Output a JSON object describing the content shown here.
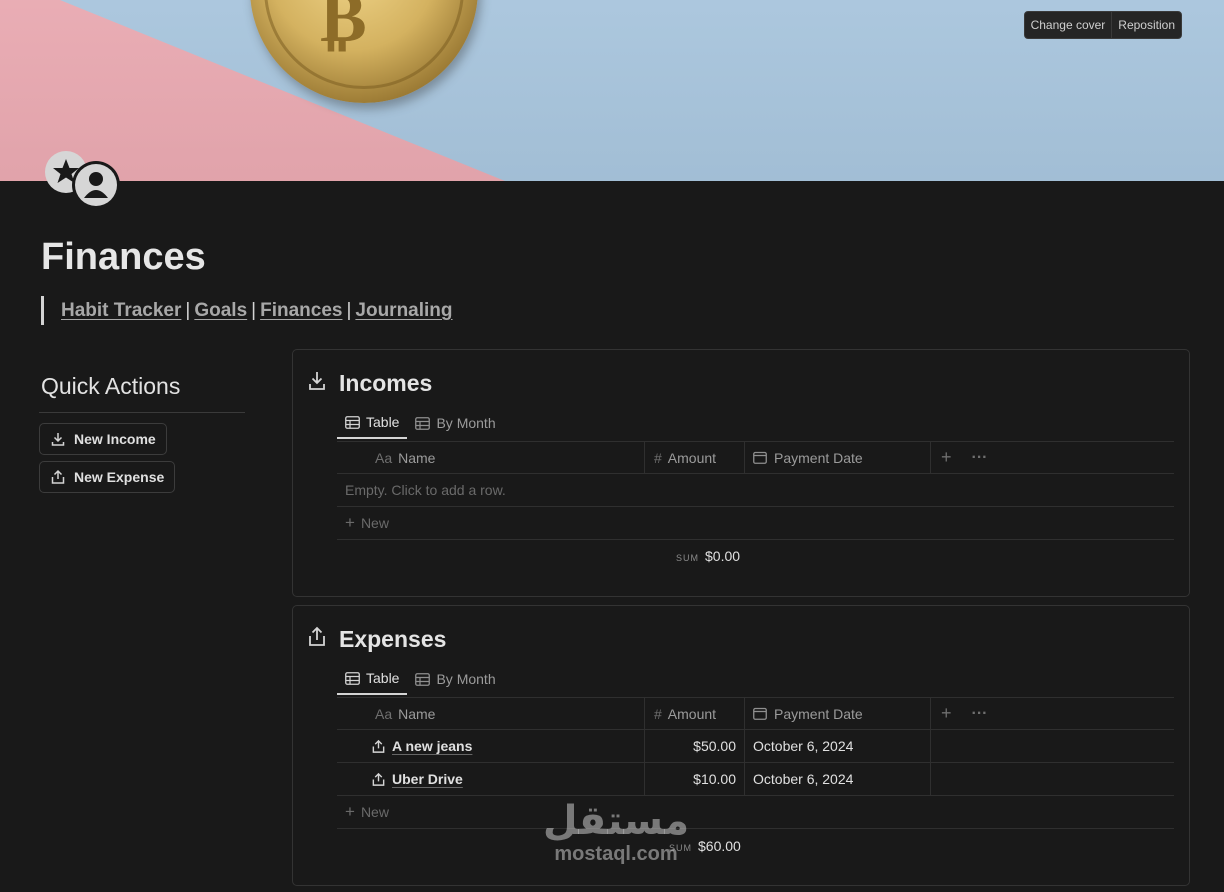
{
  "cover": {
    "change_cover": "Change cover",
    "reposition": "Reposition"
  },
  "page": {
    "title": "Finances",
    "nav": [
      {
        "label": "Habit Tracker"
      },
      {
        "label": "Goals"
      },
      {
        "label": "Finances"
      },
      {
        "label": "Journaling"
      }
    ],
    "separator": "|"
  },
  "quick_actions": {
    "title": "Quick Actions",
    "buttons": [
      {
        "label": "New Income",
        "icon": "download-icon"
      },
      {
        "label": "New Expense",
        "icon": "upload-icon"
      }
    ]
  },
  "incomes": {
    "title": "Incomes",
    "tabs": [
      {
        "label": "Table"
      },
      {
        "label": "By Month"
      }
    ],
    "columns": {
      "name_icon": "Aa",
      "name": "Name",
      "amount_icon": "#",
      "amount": "Amount",
      "date": "Payment Date"
    },
    "empty_text": "Empty. Click to add a row.",
    "new_label": "New",
    "sum_label": "SUM",
    "sum_value": "$0.00"
  },
  "expenses": {
    "title": "Expenses",
    "tabs": [
      {
        "label": "Table"
      },
      {
        "label": "By Month"
      }
    ],
    "columns": {
      "name_icon": "Aa",
      "name": "Name",
      "amount_icon": "#",
      "amount": "Amount",
      "date": "Payment Date"
    },
    "rows": [
      {
        "name": "A new jeans",
        "amount": "$50.00",
        "date": "October 6, 2024"
      },
      {
        "name": "Uber Drive",
        "amount": "$10.00",
        "date": "October 6, 2024"
      }
    ],
    "new_label": "New",
    "sum_label": "SUM",
    "sum_value": "$60.00"
  },
  "watermark": {
    "arabic": "مستقل",
    "latin": "mostaql.com"
  },
  "colors": {
    "background": "#191919",
    "cover_pink": "#e8a8b0",
    "cover_blue": "#a7c4dc",
    "coin_gold": "#d4b260"
  }
}
